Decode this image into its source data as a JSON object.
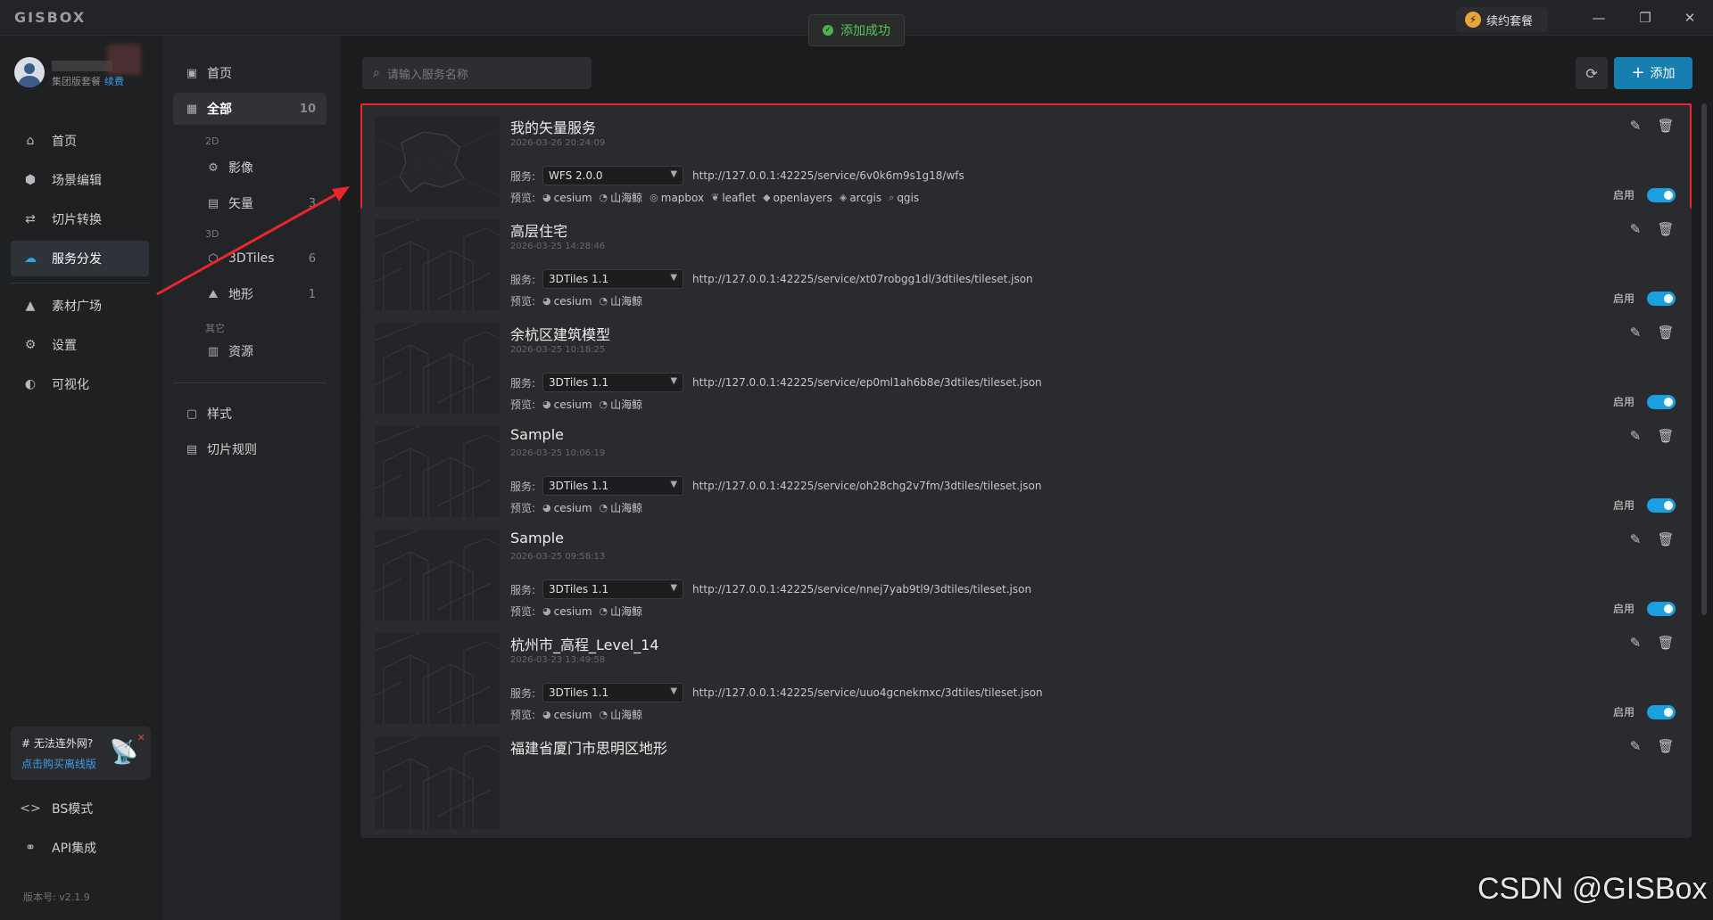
{
  "app": {
    "logo": "GISBOX",
    "renew_label": "续约套餐",
    "toast": "添加成功"
  },
  "user": {
    "plan": "集团版套餐",
    "renew_link": "续费"
  },
  "sidebar": {
    "items": [
      {
        "label": "首页",
        "icon": "home-icon"
      },
      {
        "label": "场景编辑",
        "icon": "cube-icon"
      },
      {
        "label": "切片转换",
        "icon": "swap-icon"
      },
      {
        "label": "服务分发",
        "icon": "cloud-upload-icon",
        "active": true
      },
      {
        "label": "素材广场",
        "icon": "image-icon"
      },
      {
        "label": "设置",
        "icon": "gear-icon"
      },
      {
        "label": "可视化",
        "icon": "chart-icon"
      }
    ],
    "offline": {
      "title": "# 无法连外网?",
      "link": "点击购买离线版"
    },
    "bottom": [
      {
        "label": "BS模式",
        "icon": "code-icon"
      },
      {
        "label": "API集成",
        "icon": "link-icon"
      }
    ],
    "version": "版本号: v2.1.9"
  },
  "panel": {
    "home": "首页",
    "all": {
      "label": "全部",
      "count": "10"
    },
    "group_2d": "2D",
    "imagery": "影像",
    "vector": {
      "label": "矢量",
      "count": "3"
    },
    "group_3d": "3D",
    "tiles3d": {
      "label": "3DTiles",
      "count": "6"
    },
    "terrain": {
      "label": "地形",
      "count": "1"
    },
    "group_other": "其它",
    "resource": "资源",
    "style": "样式",
    "tile_rule": "切片规则"
  },
  "toolbar": {
    "search_placeholder": "请输入服务名称",
    "add_label": "添加"
  },
  "labels": {
    "service": "服务:",
    "preview": "预览:",
    "enable": "启用"
  },
  "services": [
    {
      "name": "我的矢量服务",
      "date": "2026-03-26 20:24:09",
      "type": "WFS 2.0.0",
      "url": "http://127.0.0.1:42225/service/6v0k6m9s1g18/wfs",
      "previews": [
        "cesium",
        "山海鲸",
        "mapbox",
        "leaflet",
        "openlayers",
        "arcgis",
        "qgis"
      ],
      "enabled": true
    },
    {
      "name": "高层住宅",
      "date": "2026-03-25 14:28:46",
      "type": "3DTiles 1.1",
      "url": "http://127.0.0.1:42225/service/xt07robgg1dl/3dtiles/tileset.json",
      "previews": [
        "cesium",
        "山海鲸"
      ],
      "enabled": true
    },
    {
      "name": "余杭区建筑模型",
      "date": "2026-03-25 10:18:25",
      "type": "3DTiles 1.1",
      "url": "http://127.0.0.1:42225/service/ep0ml1ah6b8e/3dtiles/tileset.json",
      "previews": [
        "cesium",
        "山海鲸"
      ],
      "enabled": true
    },
    {
      "name": "Sample",
      "date": "2026-03-25 10:06:19",
      "type": "3DTiles 1.1",
      "url": "http://127.0.0.1:42225/service/oh28chg2v7fm/3dtiles/tileset.json",
      "previews": [
        "cesium",
        "山海鲸"
      ],
      "enabled": true
    },
    {
      "name": "Sample",
      "date": "2026-03-25 09:58:13",
      "type": "3DTiles 1.1",
      "url": "http://127.0.0.1:42225/service/nnej7yab9tl9/3dtiles/tileset.json",
      "previews": [
        "cesium",
        "山海鲸"
      ],
      "enabled": true
    },
    {
      "name": "杭州市_高程_Level_14",
      "date": "2026-03-23 13:49:58",
      "type": "3DTiles 1.1",
      "url": "http://127.0.0.1:42225/service/uuo4gcnekmxc/3dtiles/tileset.json",
      "previews": [
        "cesium",
        "山海鲸"
      ],
      "enabled": true
    },
    {
      "name": "福建省厦门市思明区地形",
      "date": "",
      "type": "",
      "url": "",
      "previews": [],
      "enabled": true
    }
  ],
  "watermark": "CSDN @GISBox",
  "colors": {
    "accent": "#1aa0e0",
    "highlight": "#e8262b",
    "toast_text": "#5ac55a"
  }
}
